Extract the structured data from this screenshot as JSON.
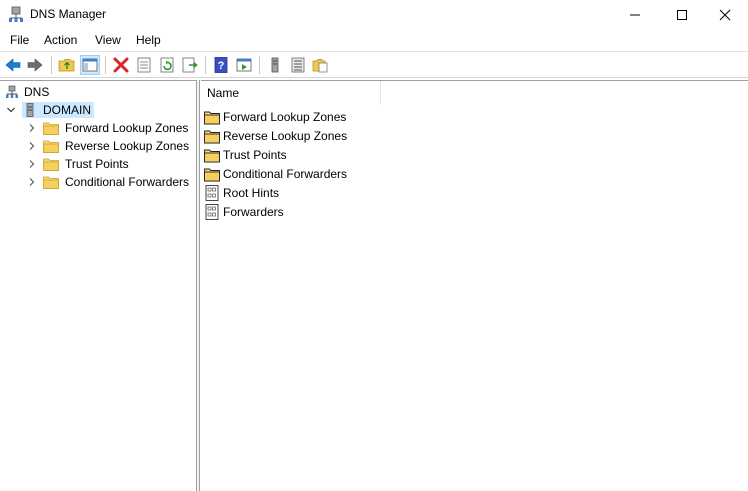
{
  "window": {
    "title": "DNS Manager"
  },
  "menu": [
    "File",
    "Action",
    "View",
    "Help"
  ],
  "icons": {
    "app": "dns-server-icon",
    "back": "arrow-left-icon",
    "forward": "arrow-right-icon",
    "folder": "folder-icon",
    "server": "server-icon"
  },
  "colors": {
    "selection": "#cce8ff",
    "folder": "#f2c94c",
    "arrow": "#1e7bd6",
    "delete": "#d9262b"
  },
  "tree": {
    "root": "DNS",
    "server": "DOMAIN",
    "children": [
      "Forward Lookup Zones",
      "Reverse Lookup Zones",
      "Trust Points",
      "Conditional Forwarders"
    ]
  },
  "list": {
    "column": "Name",
    "items": [
      {
        "label": "Forward Lookup Zones",
        "icon": "folder-icon"
      },
      {
        "label": "Reverse Lookup Zones",
        "icon": "folder-icon"
      },
      {
        "label": "Trust Points",
        "icon": "folder-icon"
      },
      {
        "label": "Conditional Forwarders",
        "icon": "folder-icon"
      },
      {
        "label": "Root Hints",
        "icon": "properties-icon"
      },
      {
        "label": "Forwarders",
        "icon": "properties-icon"
      }
    ]
  }
}
